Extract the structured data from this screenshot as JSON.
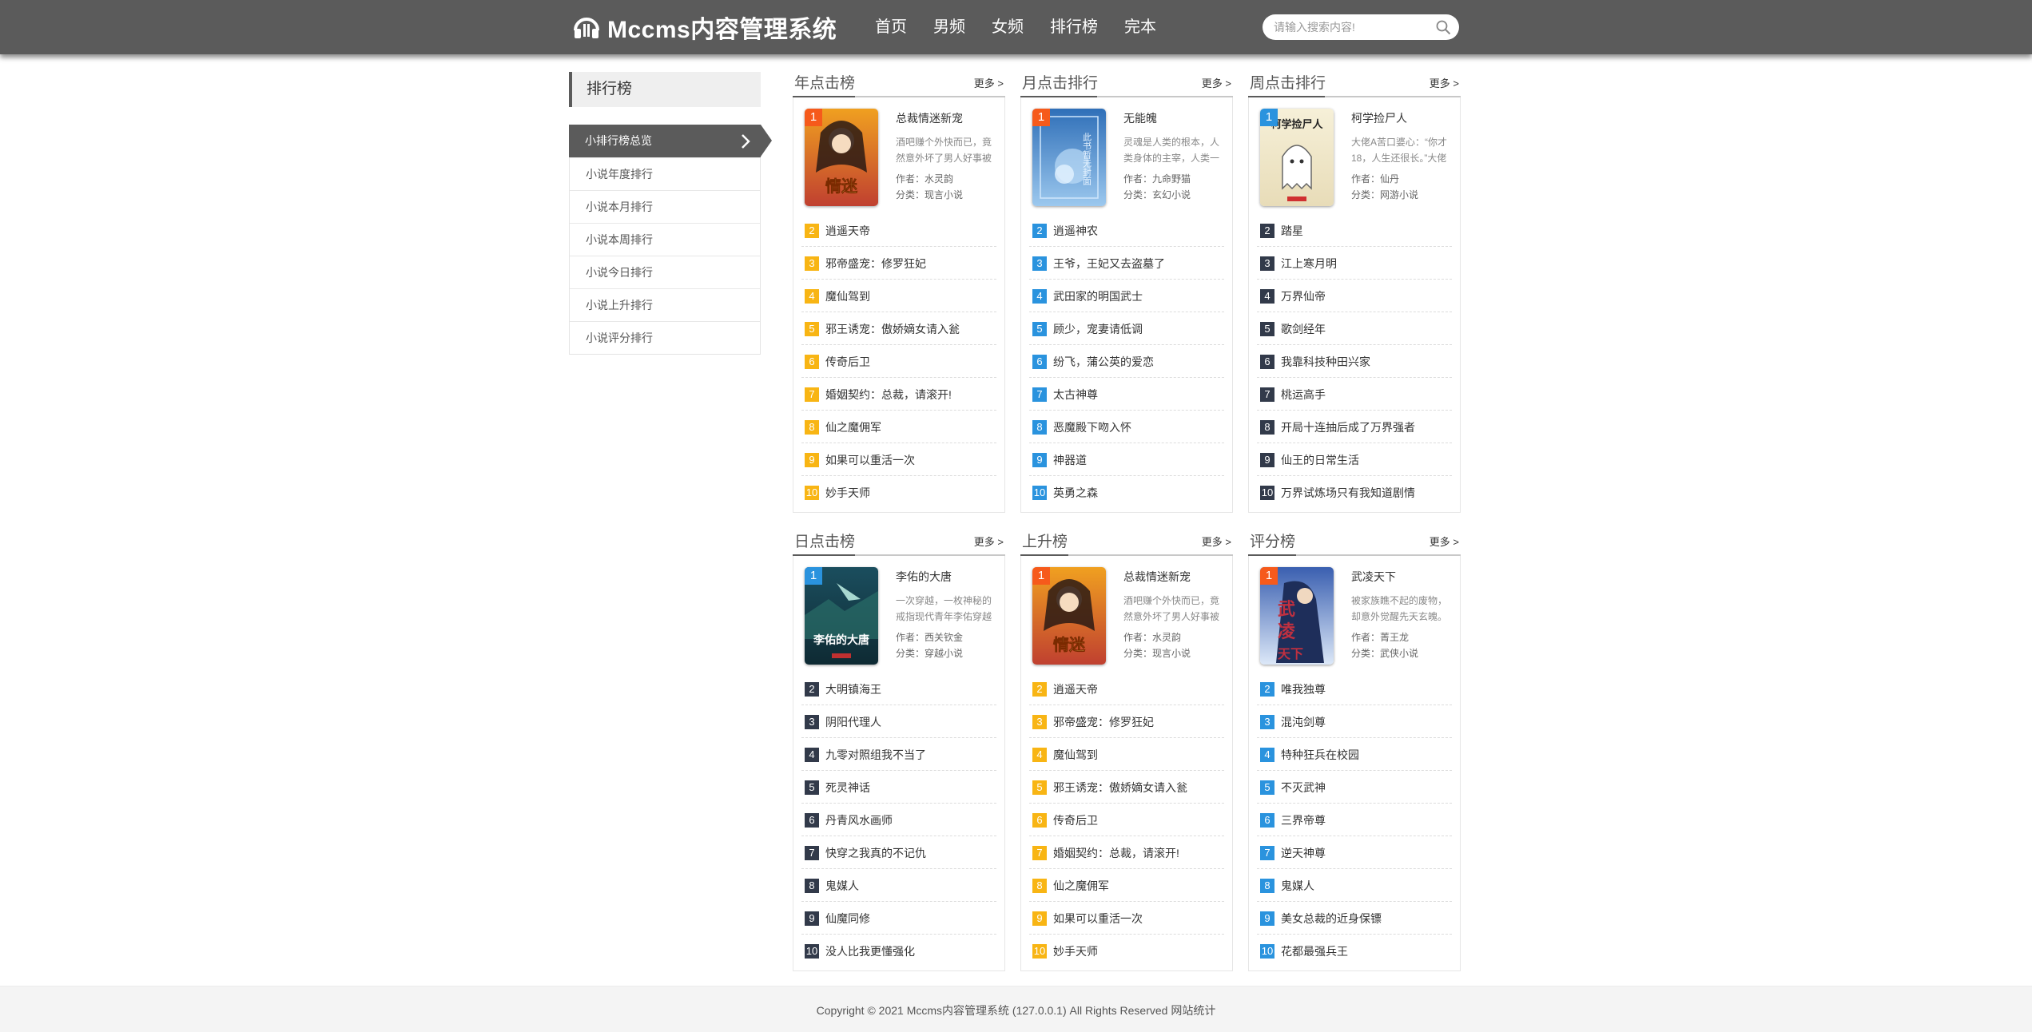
{
  "header": {
    "logo_text": "Mccms内容管理系统",
    "nav": [
      "首页",
      "男频",
      "女频",
      "排行榜",
      "完本"
    ],
    "search_placeholder": "请输入搜索内容!"
  },
  "sidebar": {
    "title": "排行榜",
    "items": [
      "小排行榜总览",
      "小说年度排行",
      "小说本月排行",
      "小说本周排行",
      "小说今日排行",
      "小说上升排行",
      "小说评分排行"
    ]
  },
  "colors": {
    "rank_orange": "#f65a1b",
    "rank_blue": "#2a93de",
    "num_yellow": "#f8b514",
    "num_blue": "#2a93de",
    "num_dark": "#323a4a"
  },
  "boards": [
    {
      "title": "年点击榜",
      "more": "更多 >",
      "top": {
        "rank": "1",
        "title": "总裁情迷新宠",
        "desc": "酒吧赚个外快而已，竟然意外坏了男人好事被",
        "author": "作者：水灵韵",
        "category": "分类：现言小说"
      },
      "list": [
        "逍遥天帝",
        "邪帝盛宠：修罗狂妃",
        "魔仙驾到",
        "邪王诱宠：傲娇嫡女请入瓮",
        "传奇后卫",
        "婚姻契约：总裁，请滚开!",
        "仙之魔佣军",
        "如果可以重活一次",
        "妙手天师"
      ]
    },
    {
      "title": "月点击排行",
      "more": "更多 >",
      "top": {
        "rank": "1",
        "title": "无能魄",
        "desc": "灵魂是人类的根本，人类身体的主宰，人类一",
        "author": "作者：九命野猫",
        "category": "分类：玄幻小说"
      },
      "list": [
        "逍遥神农",
        "王爷，王妃又去盗墓了",
        "武田家的明国武士",
        "顾少，宠妻请低调",
        "纷飞，蒲公英的爱恋",
        "太古神尊",
        "恶魔殿下吻入怀",
        "神器道",
        "英勇之森"
      ]
    },
    {
      "title": "周点击排行",
      "more": "更多 >",
      "top": {
        "rank": "1",
        "title": "柯学捡尸人",
        "desc": "大佬A苦口婆心：“你才18，人生还很长。”大佬",
        "author": "作者：仙丹",
        "category": "分类：网游小说"
      },
      "list": [
        "踏星",
        "江上寒月明",
        "万界仙帝",
        "歌剑经年",
        "我靠科技种田兴家",
        "桃运高手",
        "开局十连抽后成了万界强者",
        "仙王的日常生活",
        "万界试炼场只有我知道剧情"
      ]
    },
    {
      "title": "日点击榜",
      "more": "更多 >",
      "top": {
        "rank": "1",
        "title": "李佑的大唐",
        "desc": "一次穿越，一枚神秘的戒指现代青年李佑穿越",
        "author": "作者：西关钦金",
        "category": "分类：穿越小说"
      },
      "list": [
        "大明镇海王",
        "阴阳代理人",
        "九零对照组我不当了",
        "死灵神话",
        "丹青风水画师",
        "快穿之我真的不记仇",
        "鬼媒人",
        "仙魔同修",
        "没人比我更懂强化"
      ]
    },
    {
      "title": "上升榜",
      "more": "更多 >",
      "top": {
        "rank": "1",
        "title": "总裁情迷新宠",
        "desc": "酒吧赚个外快而已，竟然意外坏了男人好事被",
        "author": "作者：水灵韵",
        "category": "分类：现言小说"
      },
      "list": [
        "逍遥天帝",
        "邪帝盛宠：修罗狂妃",
        "魔仙驾到",
        "邪王诱宠：傲娇嫡女请入瓮",
        "传奇后卫",
        "婚姻契约：总裁，请滚开!",
        "仙之魔佣军",
        "如果可以重活一次",
        "妙手天师"
      ]
    },
    {
      "title": "评分榜",
      "more": "更多 >",
      "top": {
        "rank": "1",
        "title": "武凌天下",
        "desc": "被家族瞧不起的废物，却意外觉醒先天玄魄。",
        "author": "作者：菁王龙",
        "category": "分类：武侠小说"
      },
      "list": [
        "唯我独尊",
        "混沌剑尊",
        "特种狂兵在校园",
        "不灭武神",
        "三界帝尊",
        "逆天神尊",
        "鬼媒人",
        "美女总裁的近身保镖",
        "花都最强兵王"
      ]
    }
  ],
  "footer": {
    "copyright": "Copyright © 2021 Mccms内容管理系统 (127.0.0.1) All Rights Reserved 网站统计"
  }
}
